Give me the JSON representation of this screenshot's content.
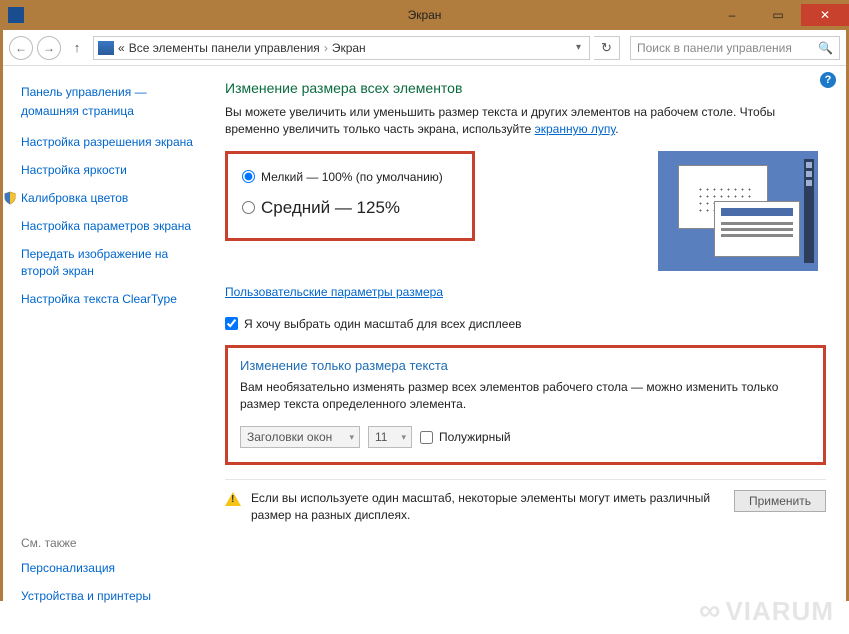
{
  "window": {
    "title": "Экран",
    "minimize": "–",
    "maximize": "▭",
    "close": "✕"
  },
  "nav": {
    "back": "←",
    "forward": "→",
    "up": "↑",
    "breadcrumb_prefix": "«",
    "breadcrumb1": "Все элементы панели управления",
    "breadcrumb_sep": "›",
    "breadcrumb2": "Экран",
    "refresh": "↻",
    "search_placeholder": "Поиск в панели управления",
    "search_icon": "🔍"
  },
  "sidebar": {
    "home_line1": "Панель управления —",
    "home_line2": "домашняя страница",
    "links": [
      "Настройка разрешения экрана",
      "Настройка яркости",
      "Калибровка цветов",
      "Настройка параметров экрана",
      "Передать изображение на второй экран",
      "Настройка текста ClearType"
    ],
    "see_also_header": "См. также",
    "see_also": [
      "Персонализация",
      "Устройства и принтеры"
    ]
  },
  "main": {
    "help": "?",
    "heading": "Изменение размера всех элементов",
    "intro_pre": "Вы можете увеличить или уменьшить размер текста и других элементов на рабочем столе. Чтобы временно увеличить только часть экрана, используйте ",
    "intro_link": "экранную лупу",
    "intro_post": ".",
    "radio_small": "Мелкий — 100% (по умолчанию)",
    "radio_medium": "Средний — 125%",
    "custom_link": "Пользовательские параметры размера",
    "checkbox_one_scale": "Я хочу выбрать один масштаб для всех дисплеев",
    "text_heading": "Изменение только размера текста",
    "text_intro": "Вам необязательно изменять размер всех элементов рабочего стола — можно изменить только размер текста определенного элемента.",
    "combo_element": "Заголовки окон",
    "combo_size": "11",
    "bold_label": "Полужирный",
    "warning": "Если вы используете один масштаб, некоторые элементы могут иметь различный размер на разных дисплеях.",
    "apply": "Применить"
  },
  "watermark": "VIARUM"
}
